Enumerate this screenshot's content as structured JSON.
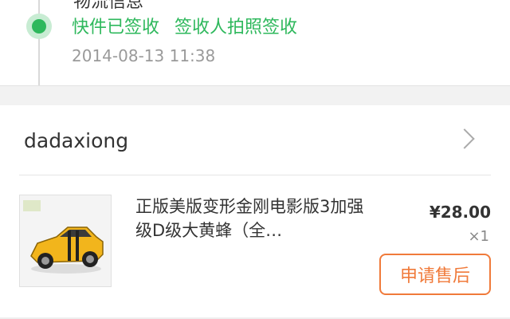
{
  "tracking": {
    "title": "物流信息",
    "status": "快件已签收 签收人拍照签收",
    "time": "2014-08-13 11:38"
  },
  "shop": {
    "name": "dadaxiong"
  },
  "product": {
    "title": "正版美版变形金刚电影版3加强级D级大黄蜂（全…",
    "price": "¥28.00",
    "quantity": "×1",
    "after_sale_label": "申请售后"
  },
  "colors": {
    "accent_green": "#2eb85c",
    "accent_orange": "#f07a3a"
  }
}
